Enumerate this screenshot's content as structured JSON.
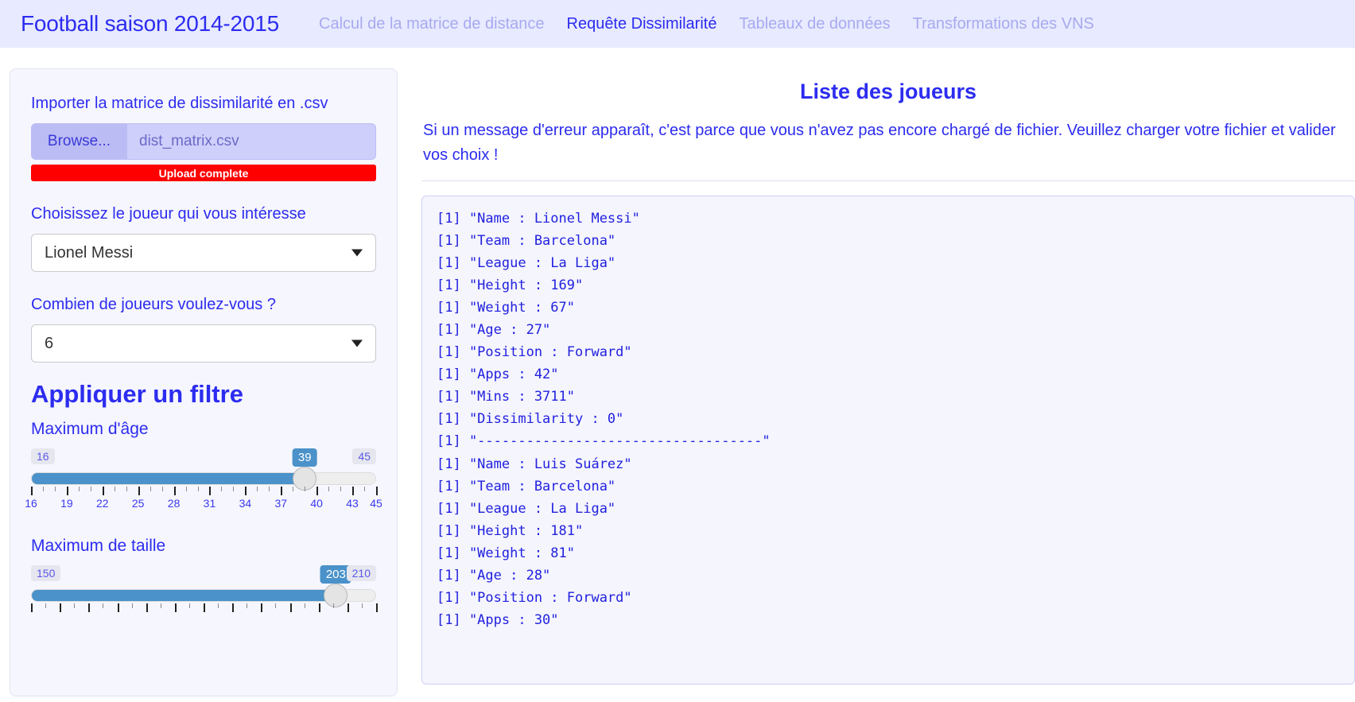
{
  "navbar": {
    "brand": "Football saison 2014-2015",
    "items": [
      {
        "label": "Calcul de la matrice de distance",
        "active": false
      },
      {
        "label": "Requête Dissimilarité",
        "active": true
      },
      {
        "label": "Tableaux de données",
        "active": false
      },
      {
        "label": "Transformations des VNS",
        "active": false
      }
    ]
  },
  "sidebar": {
    "import_label": "Importer la matrice de dissimilarité en .csv",
    "browse_label": "Browse...",
    "file_name": "dist_matrix.csv",
    "upload_status": "Upload complete",
    "upload_status_color": "#ff0000",
    "player_label": "Choisissez le joueur qui vous intéresse",
    "player_value": "Lionel Messi",
    "count_label": "Combien de joueurs voulez-vous ?",
    "count_value": "6",
    "filter_title": "Appliquer un filtre",
    "sliders": [
      {
        "label": "Maximum d'âge",
        "min": "16",
        "max": "45",
        "value": "39",
        "min_num": 16,
        "max_num": 45,
        "value_num": 39,
        "tick_labels": [
          "16",
          "19",
          "22",
          "25",
          "28",
          "31",
          "34",
          "37",
          "40",
          "43",
          "45"
        ],
        "tick_values": [
          16,
          19,
          22,
          25,
          28,
          31,
          34,
          37,
          40,
          43,
          45
        ],
        "minor_step": 1
      },
      {
        "label": "Maximum de taille",
        "min": "150",
        "max": "210",
        "value": "203",
        "min_num": 150,
        "max_num": 210,
        "value_num": 203,
        "tick_labels": [],
        "tick_values": [
          150,
          155,
          160,
          165,
          170,
          175,
          180,
          185,
          190,
          195,
          200,
          205,
          210
        ],
        "minor_step": 2.5
      }
    ]
  },
  "main": {
    "title": "Liste des joueurs",
    "note": "Si un message d'erreur apparaît, c'est parce que vous n'avez pas encore chargé de fichier. Veuillez charger votre fichier et valider vos choix !",
    "console_output": "[1] \"Name : Lionel Messi\"\n[1] \"Team : Barcelona\"\n[1] \"League : La Liga\"\n[1] \"Height : 169\"\n[1] \"Weight : 67\"\n[1] \"Age : 27\"\n[1] \"Position : Forward\"\n[1] \"Apps : 42\"\n[1] \"Mins : 3711\"\n[1] \"Dissimilarity : 0\"\n[1] \"-----------------------------------\"\n[1] \"Name : Luis Suárez\"\n[1] \"Team : Barcelona\"\n[1] \"League : La Liga\"\n[1] \"Height : 181\"\n[1] \"Weight : 81\"\n[1] \"Age : 28\"\n[1] \"Position : Forward\"\n[1] \"Apps : 30\""
  }
}
